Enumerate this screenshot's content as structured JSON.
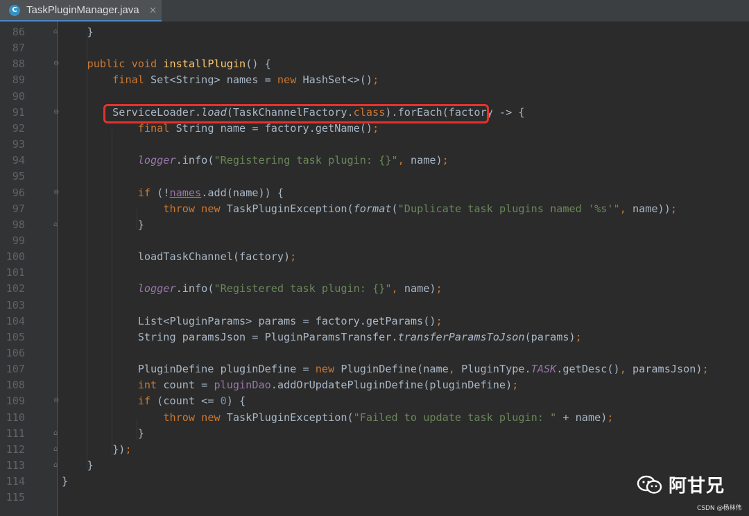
{
  "tab": {
    "title": "TaskPluginManager.java",
    "icon": "C",
    "close": "×"
  },
  "lines": [
    {
      "n": "86",
      "fold": "close",
      "html": "    }"
    },
    {
      "n": "87",
      "fold": "",
      "html": ""
    },
    {
      "n": "88",
      "fold": "open",
      "html": "    <span class='k'>public void </span><span class='f'>installPlugin</span>() {"
    },
    {
      "n": "89",
      "fold": "",
      "html": "        <span class='k'>final </span>Set&lt;String&gt; names = <span class='k'>new </span>HashSet&lt;&gt;()<span class='k'>;</span>"
    },
    {
      "n": "90",
      "fold": "",
      "html": ""
    },
    {
      "n": "91",
      "fold": "open",
      "html": "        ServiceLoader.<span class='i'>load</span>(TaskChannelFactory.<span class='k'>class</span>).forEach(factory -&gt; {"
    },
    {
      "n": "92",
      "fold": "",
      "html": "            <span class='k'>final </span>String name = factory.getName()<span class='k'>;</span>"
    },
    {
      "n": "93",
      "fold": "",
      "html": ""
    },
    {
      "n": "94",
      "fold": "",
      "html": "            <span class='ci'>logger</span>.info(<span class='s'>\"Registering task plugin: {}\"</span><span class='k'>, </span>name)<span class='k'>;</span>"
    },
    {
      "n": "95",
      "fold": "",
      "html": ""
    },
    {
      "n": "96",
      "fold": "open",
      "html": "            <span class='k'>if </span>(!<span class='c u'>names</span>.add(name)) {"
    },
    {
      "n": "97",
      "fold": "",
      "html": "                <span class='k'>throw new </span>TaskPluginException(<span class='i'>format</span>(<span class='s'>\"Duplicate task plugins named '%s'\"</span><span class='k'>, </span>name))<span class='k'>;</span>"
    },
    {
      "n": "98",
      "fold": "close",
      "html": "            }"
    },
    {
      "n": "99",
      "fold": "",
      "html": ""
    },
    {
      "n": "100",
      "fold": "",
      "html": "            loadTaskChannel(factory)<span class='k'>;</span>"
    },
    {
      "n": "101",
      "fold": "",
      "html": ""
    },
    {
      "n": "102",
      "fold": "",
      "html": "            <span class='ci'>logger</span>.info(<span class='s'>\"Registered task plugin: {}\"</span><span class='k'>, </span>name)<span class='k'>;</span>"
    },
    {
      "n": "103",
      "fold": "",
      "html": ""
    },
    {
      "n": "104",
      "fold": "",
      "html": "            List&lt;PluginParams&gt; params = factory.getParams()<span class='k'>;</span>"
    },
    {
      "n": "105",
      "fold": "",
      "html": "            String paramsJson = PluginParamsTransfer.<span class='i'>transferParamsToJson</span>(params)<span class='k'>;</span>"
    },
    {
      "n": "106",
      "fold": "",
      "html": ""
    },
    {
      "n": "107",
      "fold": "",
      "html": "            PluginDefine pluginDefine = <span class='k'>new </span>PluginDefine(name<span class='k'>, </span>PluginType.<span class='ci'>TASK</span>.getDesc()<span class='k'>, </span>paramsJson)<span class='k'>;</span>"
    },
    {
      "n": "108",
      "fold": "",
      "html": "            <span class='k'>int </span>count = <span class='c'>pluginDao</span>.addOrUpdatePluginDefine(pluginDefine)<span class='k'>;</span>"
    },
    {
      "n": "109",
      "fold": "open",
      "html": "            <span class='k'>if </span>(count &lt;= <span class='n'>0</span>) {"
    },
    {
      "n": "110",
      "fold": "",
      "html": "                <span class='k'>throw new </span>TaskPluginException(<span class='s'>\"Failed to update task plugin: \" </span>+ name)<span class='k'>;</span>"
    },
    {
      "n": "111",
      "fold": "close",
      "html": "            }"
    },
    {
      "n": "112",
      "fold": "close",
      "html": "        })<span class='k'>;</span>"
    },
    {
      "n": "113",
      "fold": "close",
      "html": "    }"
    },
    {
      "n": "114",
      "fold": "",
      "html": "}"
    },
    {
      "n": "115",
      "fold": "",
      "html": ""
    }
  ],
  "watermark": {
    "name": "阿甘兄",
    "credit": "CSDN @杨林伟"
  }
}
